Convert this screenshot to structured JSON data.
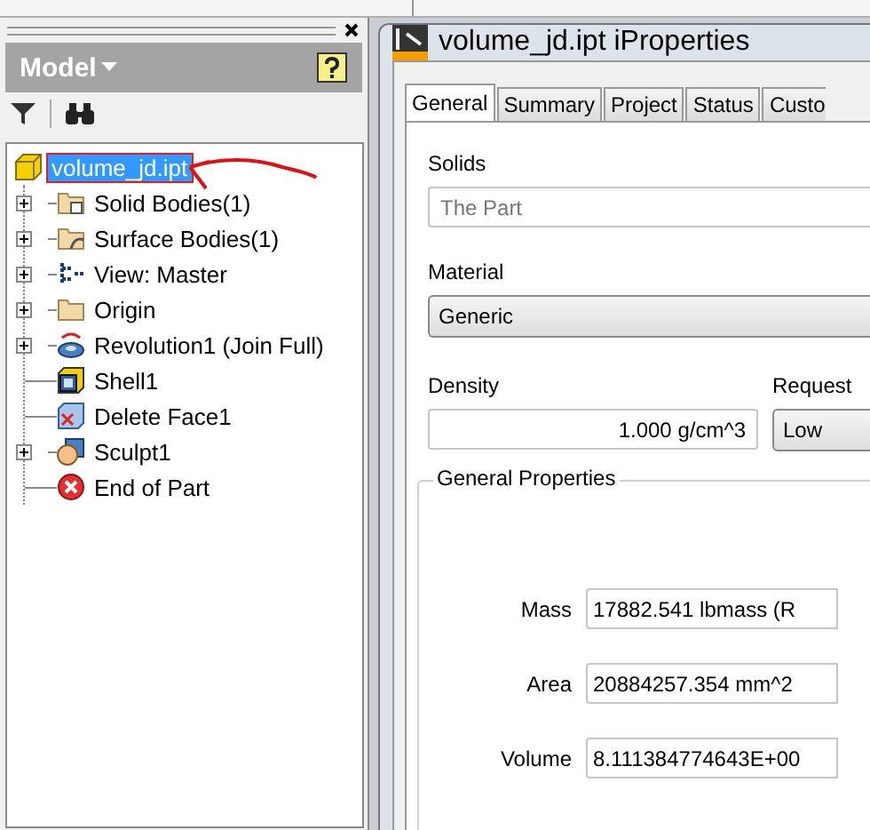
{
  "browser": {
    "title": "Model"
  },
  "tree": {
    "label": "volume_jd.ipt",
    "kind": "part",
    "selected": true,
    "children": [
      {
        "label": "Solid Bodies(1)",
        "kind": "bodies",
        "expandable": true,
        "selected": false
      },
      {
        "label": "Surface Bodies(1)",
        "kind": "surfaces",
        "expandable": true,
        "selected": false
      },
      {
        "label": "View: Master",
        "kind": "view",
        "expandable": true,
        "selected": false
      },
      {
        "label": "Origin",
        "kind": "folder",
        "expandable": true,
        "selected": false
      },
      {
        "label": "Revolution1 (Join Full)",
        "kind": "revolve",
        "expandable": true,
        "selected": false
      },
      {
        "label": "Shell1",
        "kind": "shell",
        "expandable": false,
        "selected": false
      },
      {
        "label": "Delete Face1",
        "kind": "delete-face",
        "expandable": false,
        "selected": false
      },
      {
        "label": "Sculpt1",
        "kind": "sculpt",
        "expandable": true,
        "selected": false
      },
      {
        "label": "End of Part",
        "kind": "end",
        "expandable": false,
        "selected": false
      }
    ]
  },
  "dialog": {
    "title": "volume_jd.ipt iProperties",
    "tabs": [
      {
        "label": "General",
        "selected": true
      },
      {
        "label": "Summary",
        "selected": false
      },
      {
        "label": "Project",
        "selected": false
      },
      {
        "label": "Status",
        "selected": false
      },
      {
        "label": "Custo",
        "selected": false
      }
    ],
    "solids": {
      "label": "Solids",
      "value": "The Part",
      "disabled": true
    },
    "material": {
      "label": "Material",
      "value": "Generic"
    },
    "density": {
      "label": "Density",
      "value": "1.000 g/cm^3"
    },
    "accuracy": {
      "label": "Request",
      "value": "Low"
    },
    "general_properties": {
      "title": "General Properties",
      "rows": [
        {
          "label": "Mass",
          "value": "17882.541 lbmass (R"
        },
        {
          "label": "Area",
          "value": "20884257.354 mm^2"
        },
        {
          "label": "Volume",
          "value": "8.111384774643E+00"
        }
      ]
    }
  }
}
